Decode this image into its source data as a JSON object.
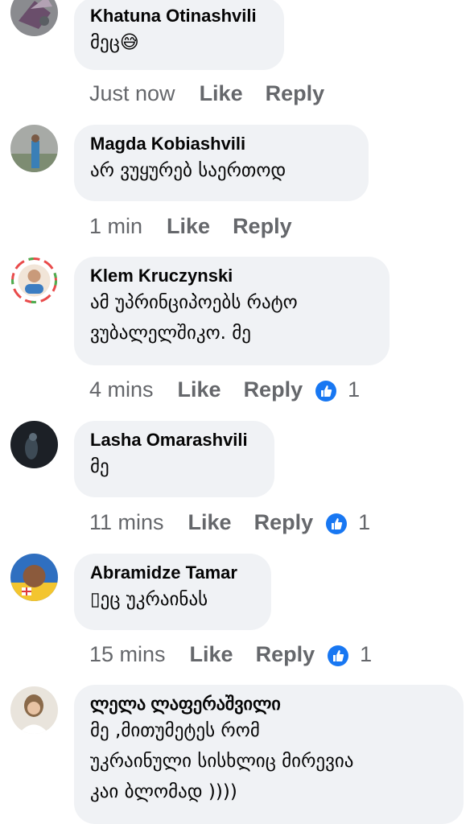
{
  "comments": [
    {
      "name": "Khatuna Otinashvili",
      "lines": [
        "მეც😅"
      ],
      "time": "Just now",
      "like_label": "Like",
      "reply_label": "Reply",
      "reactions": null
    },
    {
      "name": "Magda Kobiashvili",
      "lines": [
        "არ ვუყურებ საერთოდ"
      ],
      "time": "1 min",
      "like_label": "Like",
      "reply_label": "Reply",
      "reactions": null
    },
    {
      "name": "Klem Kruczynski",
      "lines": [
        "ამ უპრინციპოებს რატო",
        "ვუბალელშიკო. მე"
      ],
      "time": "4 mins",
      "like_label": "Like",
      "reply_label": "Reply",
      "reactions": "1"
    },
    {
      "name": "Lasha Omarashvili",
      "lines": [
        "მე"
      ],
      "time": "11 mins",
      "like_label": "Like",
      "reply_label": "Reply",
      "reactions": "1"
    },
    {
      "name": "Abramidze Tamar",
      "lines": [
        "▯ეც უკრაინას"
      ],
      "time": "15 mins",
      "like_label": "Like",
      "reply_label": "Reply",
      "reactions": "1"
    },
    {
      "name": "ლელა ლაფერაშვილი",
      "lines": [
        "მე ,მითუმეტეს რომ",
        "უკრაინული სისხლიც მირევია",
        "კაი ბლომად ))))"
      ],
      "time": null,
      "like_label": null,
      "reply_label": null,
      "reactions": null
    }
  ],
  "colors": {
    "bubble": "#f0f2f5",
    "meta_text": "#65676b",
    "like_reaction": "#1877f2"
  },
  "icons": {
    "reaction": "thumbs-up-icon"
  }
}
